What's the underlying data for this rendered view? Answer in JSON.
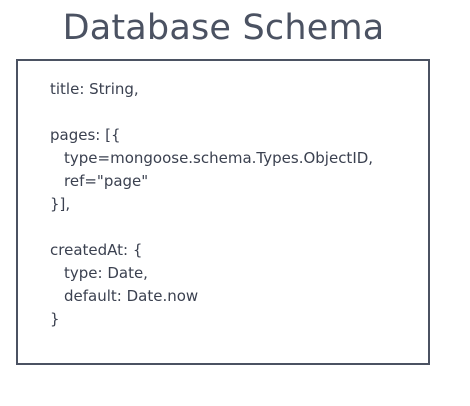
{
  "title": "Database Schema",
  "schema_lines": [
    "title: String,",
    "pages: [{",
    "type=mongoose.schema.Types.ObjectID,",
    "ref=\"page\"",
    "}],",
    "createdAt: {",
    "type: Date,",
    "default: Date.now",
    "}"
  ]
}
